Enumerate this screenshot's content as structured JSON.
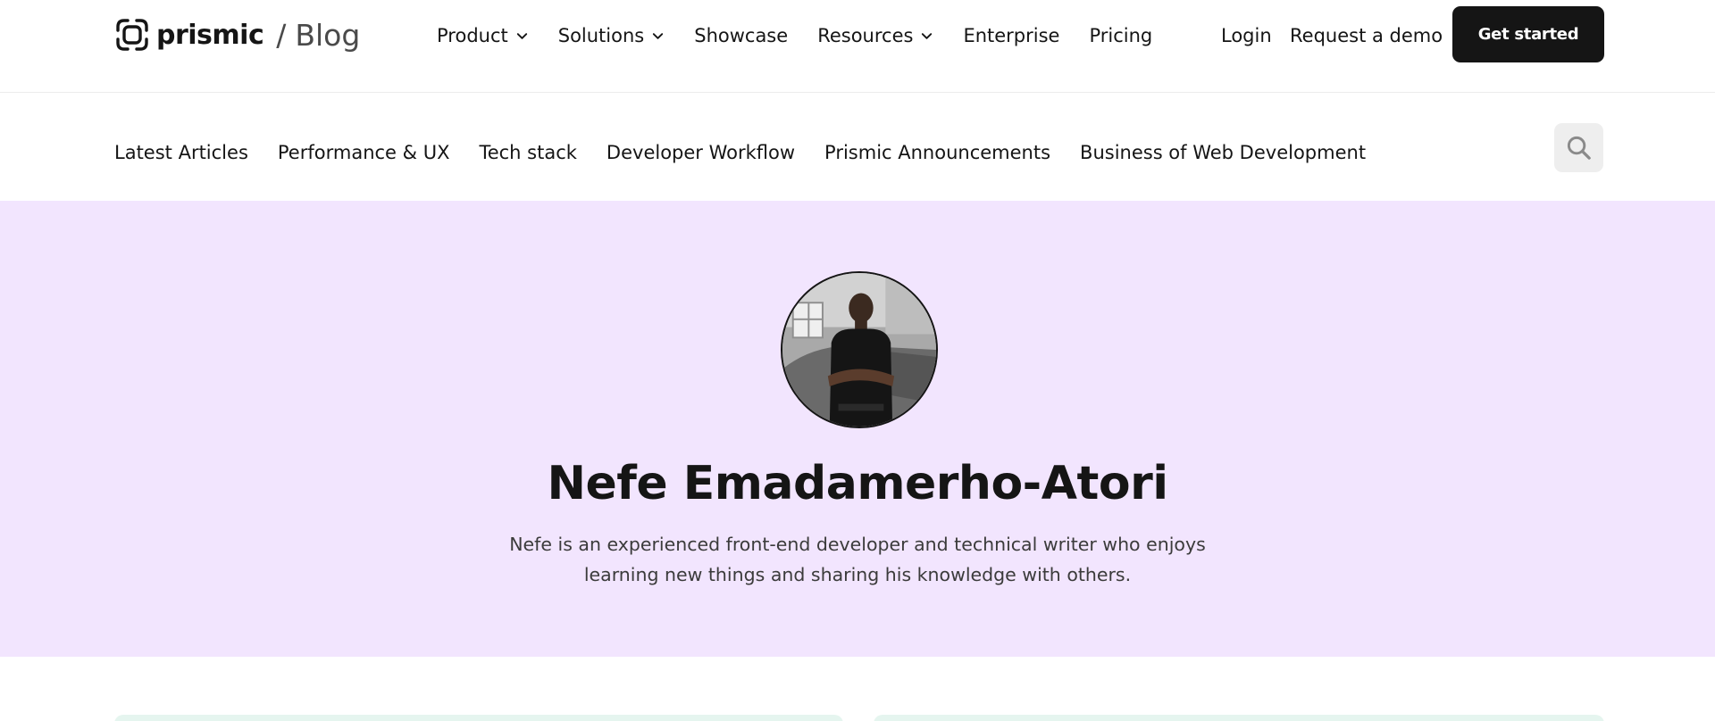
{
  "header": {
    "brand_name": "prismic",
    "brand_separator": "/",
    "brand_section": "Blog",
    "nav": [
      {
        "label": "Product",
        "has_dropdown": true
      },
      {
        "label": "Solutions",
        "has_dropdown": true
      },
      {
        "label": "Showcase",
        "has_dropdown": false
      },
      {
        "label": "Resources",
        "has_dropdown": true
      },
      {
        "label": "Enterprise",
        "has_dropdown": false
      },
      {
        "label": "Pricing",
        "has_dropdown": false
      }
    ],
    "login_label": "Login",
    "demo_label": "Request a demo",
    "cta_label": "Get started"
  },
  "categories": [
    "Latest Articles",
    "Performance & UX",
    "Tech stack",
    "Developer Workflow",
    "Prismic Announcements",
    "Business of Web Development"
  ],
  "search": {
    "icon": "search-icon"
  },
  "author": {
    "name": "Nefe Emadamerho-Atori",
    "bio": "Nefe is an experienced front-end developer and technical writer who enjoys learning new things and sharing his knowledge with others."
  },
  "colors": {
    "hero_background": "#f2e5fe",
    "cta_background": "#151515",
    "card_background": "#e5f5ef",
    "search_background": "#eeeeee"
  }
}
